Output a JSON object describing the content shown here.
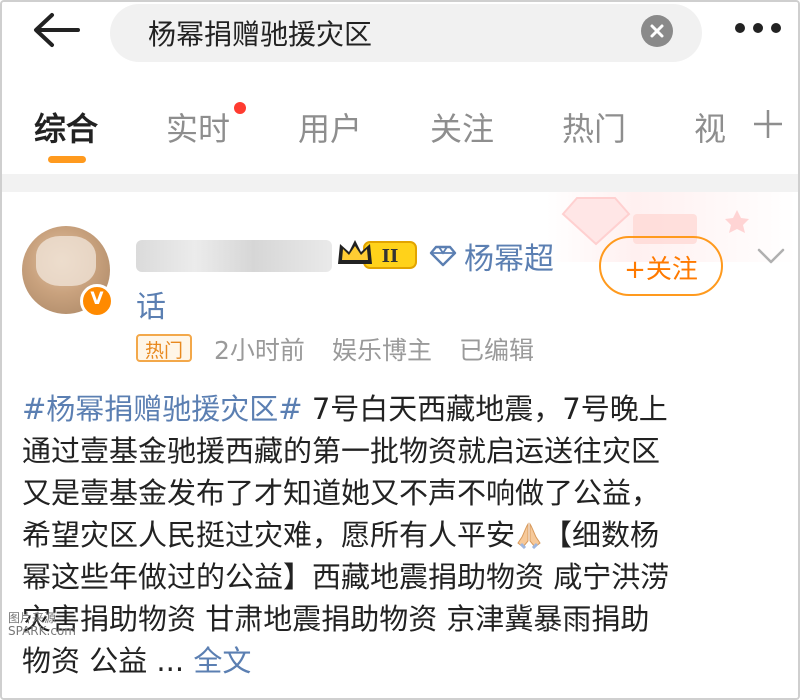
{
  "search": {
    "query": "杨幂捐赠驰援灾区"
  },
  "tabs": [
    {
      "label": "综合"
    },
    {
      "label": "实时"
    },
    {
      "label": "用户"
    },
    {
      "label": "关注"
    },
    {
      "label": "热门"
    },
    {
      "label": "视"
    }
  ],
  "post": {
    "topic_label": "杨幂超",
    "topic_label_cont": "话",
    "level_badge": "II",
    "follow_label": "+关注",
    "hot_badge": "热门",
    "time": "2小时前",
    "role": "娱乐博主",
    "edited": "已编辑",
    "body_lines": [
      {
        "tag": "#杨幂捐赠驰援灾区#",
        "text": " 7号白天西藏地震，7号晚上"
      },
      {
        "text": "通过壹基金驰援西藏的第一批物资就启运送往灾区"
      },
      {
        "text": "又是壹基金发布了才知道她又不声不响做了公益，"
      },
      {
        "text": "希望灾区人民挺过灾难，愿所有人平安",
        "after": "【细数杨"
      },
      {
        "text": "幂这些年做过的公益】西藏地震捐助物资 咸宁洪涝"
      },
      {
        "text": "灾害捐助物资 甘肃地震捐助物资 京津冀暴雨捐助"
      },
      {
        "text": "物资 公益 ... ",
        "link": "全文"
      }
    ]
  },
  "watermark": {
    "line1": "图片来源",
    "line2": "SPARK.com"
  },
  "colors": {
    "accent": "#ff9a1e",
    "link": "#5b7fb2",
    "badge": "#ff8a00",
    "red_dot": "#ff3b30"
  },
  "icons": [
    "back-arrow-icon",
    "clear-icon",
    "more-icon",
    "plus-icon",
    "crown-icon",
    "diamond-icon",
    "chevron-down-icon",
    "verified-v-icon",
    "pray-hands-icon"
  ]
}
